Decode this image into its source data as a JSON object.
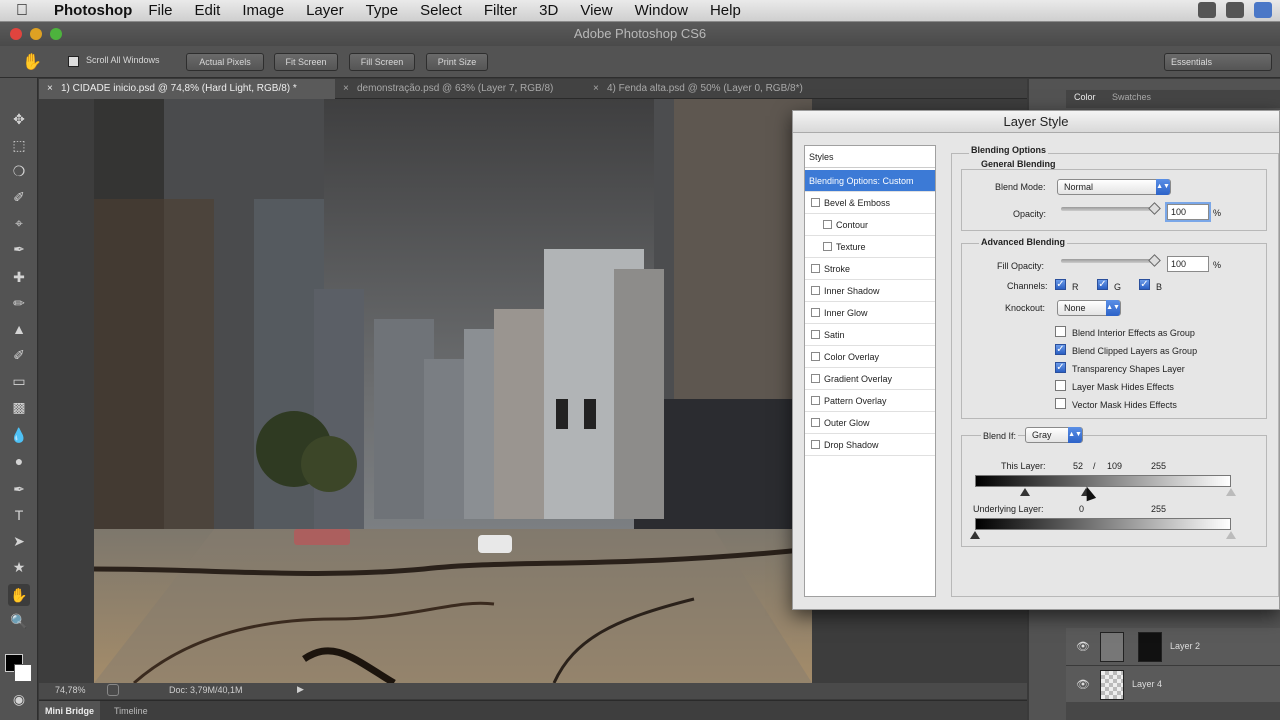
{
  "menubar": {
    "app": "Photoshop",
    "items": [
      "File",
      "Edit",
      "Image",
      "Layer",
      "Type",
      "Select",
      "Filter",
      "3D",
      "View",
      "Window",
      "Help"
    ]
  },
  "window_title": "Adobe Photoshop CS6",
  "options_bar": {
    "scroll_all": "Scroll All Windows",
    "actual_pixels": "Actual Pixels",
    "fit_screen": "Fit Screen",
    "fill_screen": "Fill Screen",
    "print_size": "Print Size",
    "workspace": "Essentials"
  },
  "tabs": [
    {
      "label": "1) CIDADE  inicio.psd @ 74,8% (Hard Light, RGB/8) *"
    },
    {
      "label": "demonstração.psd @ 63% (Layer 7, RGB/8)"
    },
    {
      "label": "4) Fenda alta.psd @ 50% (Layer 0, RGB/8*)"
    }
  ],
  "status": {
    "zoom": "74,78%",
    "doc": "Doc: 3,79M/40,1M"
  },
  "bottom_tabs": {
    "mini_bridge": "Mini Bridge",
    "timeline": "Timeline"
  },
  "right_panel": {
    "tab_color": "Color",
    "tab_swatches": "Swatches",
    "layers": [
      {
        "name": "Layer 2"
      },
      {
        "name": "Layer 4"
      }
    ]
  },
  "dialog": {
    "title": "Layer Style",
    "styles_header": "Styles",
    "styles": [
      {
        "label": "Blending Options: Custom",
        "selected": true
      },
      {
        "label": "Bevel & Emboss"
      },
      {
        "label": "Contour"
      },
      {
        "label": "Texture"
      },
      {
        "label": "Stroke"
      },
      {
        "label": "Inner Shadow"
      },
      {
        "label": "Inner Glow"
      },
      {
        "label": "Satin"
      },
      {
        "label": "Color Overlay"
      },
      {
        "label": "Gradient Overlay"
      },
      {
        "label": "Pattern Overlay"
      },
      {
        "label": "Outer Glow"
      },
      {
        "label": "Drop Shadow"
      }
    ],
    "blending_options": "Blending Options",
    "general_blending": "General Blending",
    "blend_mode_label": "Blend Mode:",
    "blend_mode": "Normal",
    "opacity_label": "Opacity:",
    "opacity": "100",
    "pct": "%",
    "advanced_blending": "Advanced Blending",
    "fill_opacity_label": "Fill Opacity:",
    "fill_opacity": "100",
    "channels_label": "Channels:",
    "ch_r": "R",
    "ch_g": "G",
    "ch_b": "B",
    "knockout_label": "Knockout:",
    "knockout": "None",
    "options": [
      {
        "label": "Blend Interior Effects as Group",
        "checked": false
      },
      {
        "label": "Blend Clipped Layers as Group",
        "checked": true
      },
      {
        "label": "Transparency Shapes Layer",
        "checked": true
      },
      {
        "label": "Layer Mask Hides Effects",
        "checked": false
      },
      {
        "label": "Vector Mask Hides Effects",
        "checked": false
      }
    ],
    "blend_if_label": "Blend If:",
    "blend_if": "Gray",
    "this_layer_label": "This Layer:",
    "this_layer_low": "52",
    "this_layer_slash": "/",
    "this_layer_mid": "109",
    "this_layer_high": "255",
    "underlying_label": "Underlying Layer:",
    "underlying_low": "0",
    "underlying_high": "255"
  },
  "colors": {
    "accent": "#3c7ad6",
    "ui_dark": "#535353"
  }
}
